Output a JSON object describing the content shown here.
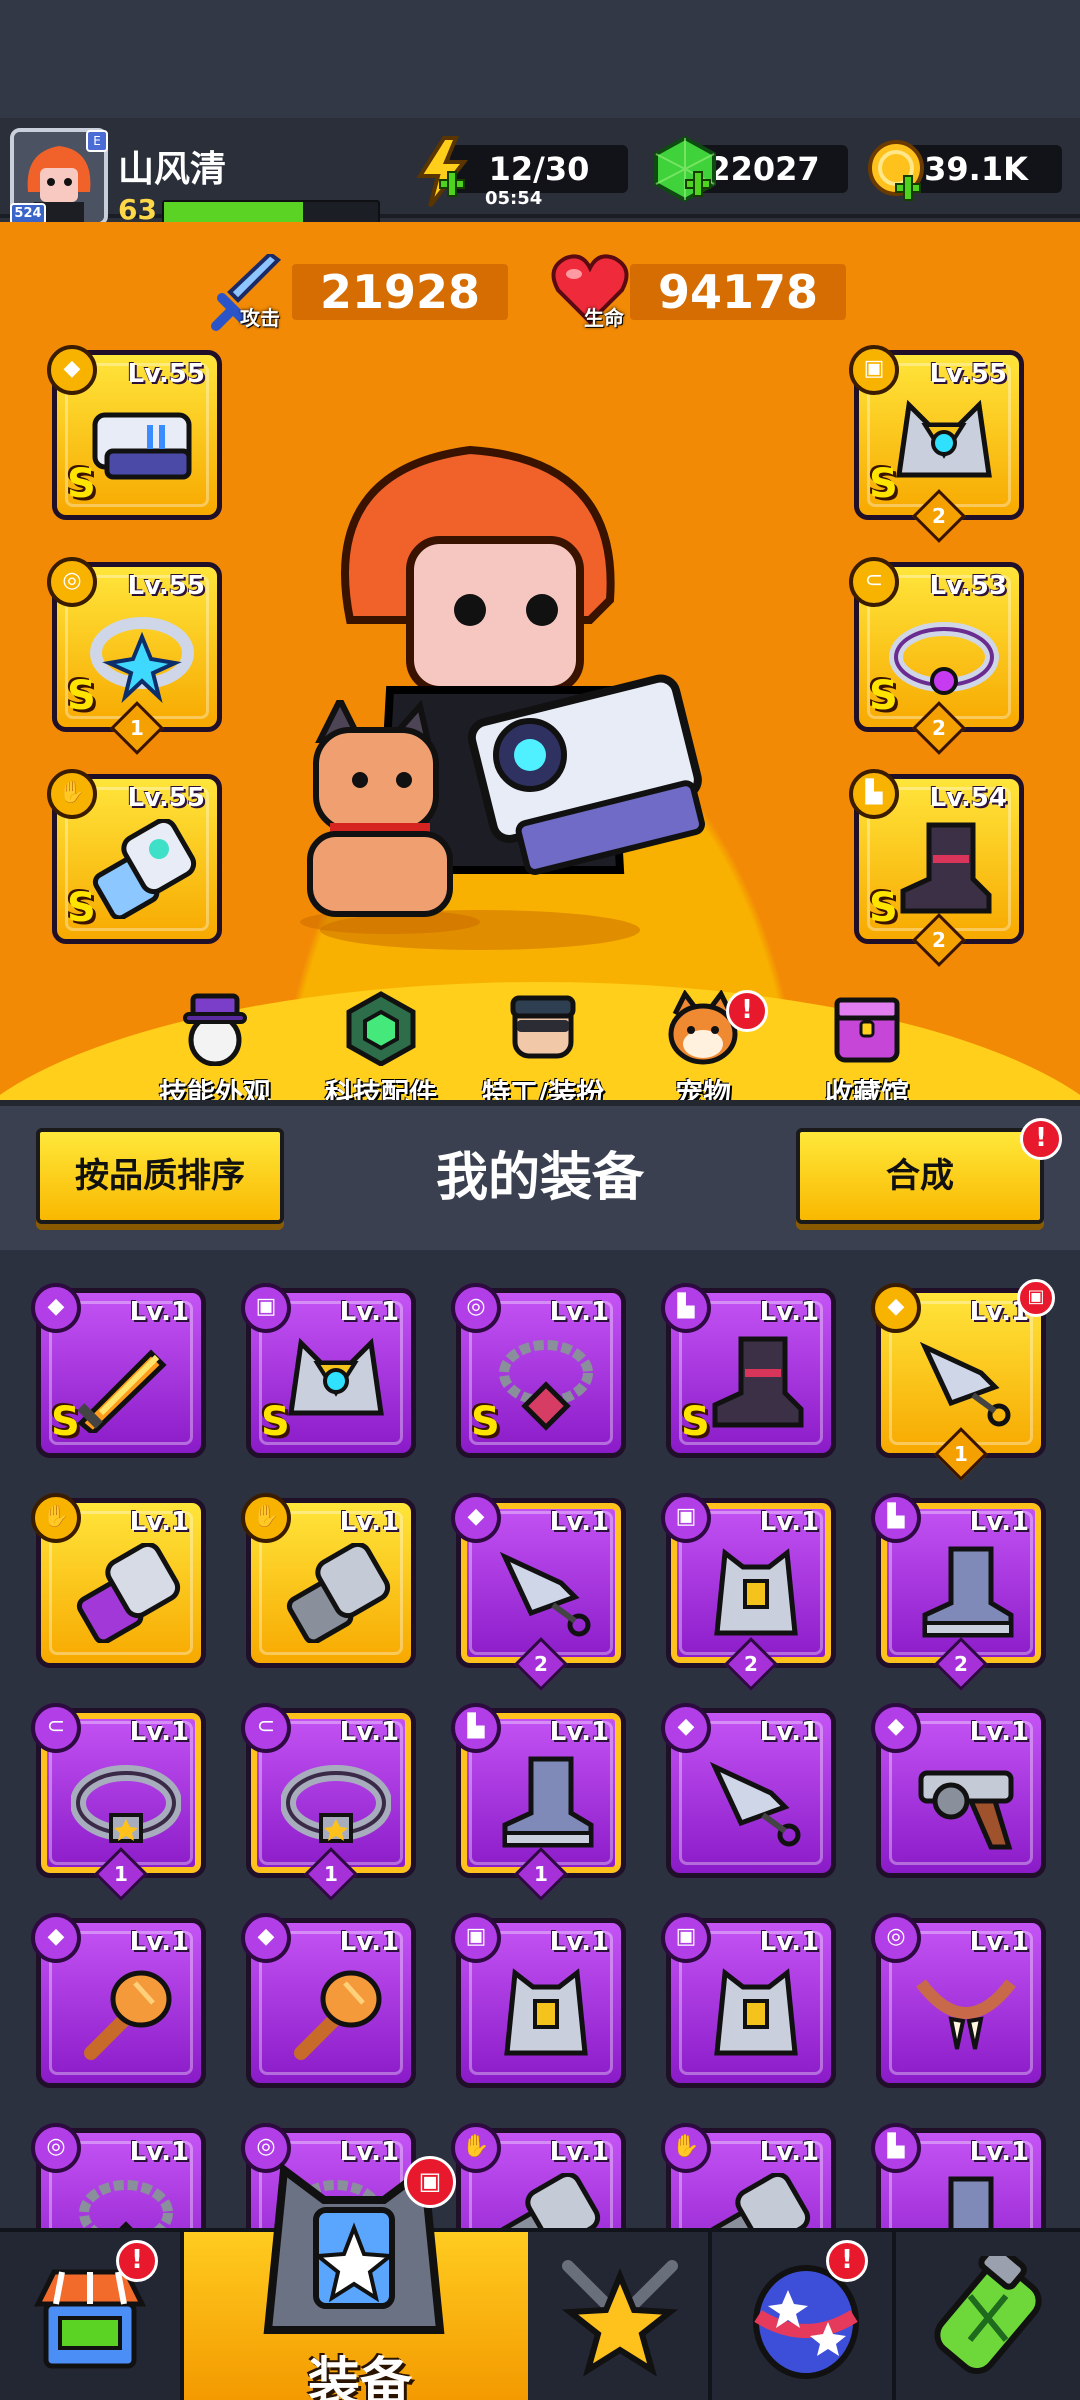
{
  "player": {
    "name": "山风清",
    "level": "63",
    "avatar_badge": "524",
    "avatar_tag": "E",
    "xp_fraction": 0.65
  },
  "resources": {
    "energy": "12/30",
    "energy_timer": "05:54",
    "gems": "22027",
    "coins": "39.1K"
  },
  "stats": {
    "attack_value": "21928",
    "attack_label": "攻击",
    "hp_value": "94178",
    "hp_label": "生命"
  },
  "equipped": {
    "left": [
      {
        "level": "Lv.55",
        "grade": "S",
        "slot_icon": "dagger-icon",
        "item": "blaster-gun-icon"
      },
      {
        "level": "Lv.55",
        "grade": "S",
        "count": "1",
        "slot_icon": "necklace-icon",
        "item": "star-necklace-icon"
      },
      {
        "level": "Lv.55",
        "grade": "S",
        "slot_icon": "glove-icon",
        "item": "mech-gauntlet-icon"
      }
    ],
    "right": [
      {
        "level": "Lv.55",
        "grade": "S",
        "count": "2",
        "slot_icon": "armor-icon",
        "item": "mech-armor-icon"
      },
      {
        "level": "Lv.53",
        "grade": "S",
        "count": "2",
        "slot_icon": "belt-icon",
        "item": "gem-belt-icon"
      },
      {
        "level": "Lv.54",
        "grade": "S",
        "count": "2",
        "slot_icon": "boot-icon",
        "item": "dark-boot-icon"
      }
    ]
  },
  "hero_menu": [
    {
      "label": "技能外观",
      "icon": "skill-skin-icon"
    },
    {
      "label": "科技配件",
      "icon": "tech-parts-icon"
    },
    {
      "label": "特工/装扮",
      "icon": "agent-outfit-icon"
    },
    {
      "label": "宠物",
      "icon": "pet-icon",
      "alert": "!"
    },
    {
      "label": "收藏馆",
      "icon": "collection-icon"
    }
  ],
  "equipment_panel": {
    "title": "我的装备",
    "sort_label": "按品质排序",
    "merge_label": "合成",
    "merge_alert": "!"
  },
  "inventory": [
    {
      "level": "Lv.1",
      "rarity": "purple",
      "grade": "S",
      "slot_icon": "dagger-icon",
      "item": "flame-sword-icon"
    },
    {
      "level": "Lv.1",
      "rarity": "purple",
      "grade": "S",
      "slot_icon": "armor-icon",
      "item": "mech-armor-icon"
    },
    {
      "level": "Lv.1",
      "rarity": "purple",
      "grade": "S",
      "slot_icon": "necklace-icon",
      "item": "chain-necklace-icon"
    },
    {
      "level": "Lv.1",
      "rarity": "purple",
      "grade": "S",
      "slot_icon": "boot-icon",
      "item": "dark-boot-icon"
    },
    {
      "level": "Lv.1",
      "rarity": "gold",
      "count": "1",
      "slot_icon": "dagger-icon",
      "item": "kunai-icon",
      "alert": true
    },
    {
      "level": "Lv.1",
      "rarity": "gold",
      "slot_icon": "glove-icon",
      "item": "purple-gauntlet-icon"
    },
    {
      "level": "Lv.1",
      "rarity": "gold",
      "slot_icon": "glove-icon",
      "item": "steel-gauntlet-icon"
    },
    {
      "level": "Lv.1",
      "rarity": "purple",
      "count": "2",
      "slot_icon": "dagger-icon",
      "item": "kunai-icon",
      "framed": true
    },
    {
      "level": "Lv.1",
      "rarity": "purple",
      "count": "2",
      "slot_icon": "armor-icon",
      "item": "vest-icon",
      "framed": true
    },
    {
      "level": "Lv.1",
      "rarity": "purple",
      "count": "2",
      "slot_icon": "boot-icon",
      "item": "boot-icon",
      "framed": true
    },
    {
      "level": "Lv.1",
      "rarity": "purple",
      "count": "1",
      "slot_icon": "belt-icon",
      "item": "star-belt-icon",
      "framed": true
    },
    {
      "level": "Lv.1",
      "rarity": "purple",
      "count": "1",
      "slot_icon": "belt-icon",
      "item": "star-belt-icon",
      "framed": true
    },
    {
      "level": "Lv.1",
      "rarity": "purple",
      "count": "1",
      "slot_icon": "boot-icon",
      "item": "boot-icon",
      "framed": true
    },
    {
      "level": "Lv.1",
      "rarity": "purple",
      "slot_icon": "dagger-icon",
      "item": "kunai-icon"
    },
    {
      "level": "Lv.1",
      "rarity": "purple",
      "slot_icon": "dagger-icon",
      "item": "revolver-icon"
    },
    {
      "level": "Lv.1",
      "rarity": "purple",
      "slot_icon": "dagger-icon",
      "item": "mace-icon"
    },
    {
      "level": "Lv.1",
      "rarity": "purple",
      "slot_icon": "dagger-icon",
      "item": "mace-icon"
    },
    {
      "level": "Lv.1",
      "rarity": "purple",
      "slot_icon": "armor-icon",
      "item": "vest-icon"
    },
    {
      "level": "Lv.1",
      "rarity": "purple",
      "slot_icon": "armor-icon",
      "item": "vest-icon"
    },
    {
      "level": "Lv.1",
      "rarity": "purple",
      "slot_icon": "necklace-icon",
      "item": "fang-necklace-icon"
    },
    {
      "level": "Lv.1",
      "rarity": "purple",
      "slot_icon": "necklace-icon",
      "item": "chain-necklace-icon"
    },
    {
      "level": "Lv.1",
      "rarity": "purple",
      "slot_icon": "necklace-icon",
      "item": "chain-necklace-icon"
    },
    {
      "level": "Lv.1",
      "rarity": "purple",
      "slot_icon": "glove-icon",
      "item": "steel-gauntlet-icon"
    },
    {
      "level": "Lv.1",
      "rarity": "purple",
      "slot_icon": "glove-icon",
      "item": "steel-gauntlet-icon"
    },
    {
      "level": "Lv.1",
      "rarity": "purple",
      "slot_icon": "boot-icon",
      "item": "boot-icon"
    }
  ],
  "bottom_nav": [
    {
      "id": "shop",
      "icon": "shop-icon",
      "alert": "!"
    },
    {
      "id": "equip",
      "icon": "equip-armor-icon",
      "label": "装备",
      "alert_icon": "armor-icon"
    },
    {
      "id": "battle",
      "icon": "star-swords-icon"
    },
    {
      "id": "events",
      "icon": "star-egg-icon",
      "alert": "!"
    },
    {
      "id": "lab",
      "icon": "dna-capsule-icon"
    }
  ],
  "colors": {
    "hero_bg": "#f28a05",
    "gold_card": "#ffd21e",
    "purple_card": "#a932df",
    "alert_red": "#e8192c",
    "xp_green": "#5ad324"
  }
}
